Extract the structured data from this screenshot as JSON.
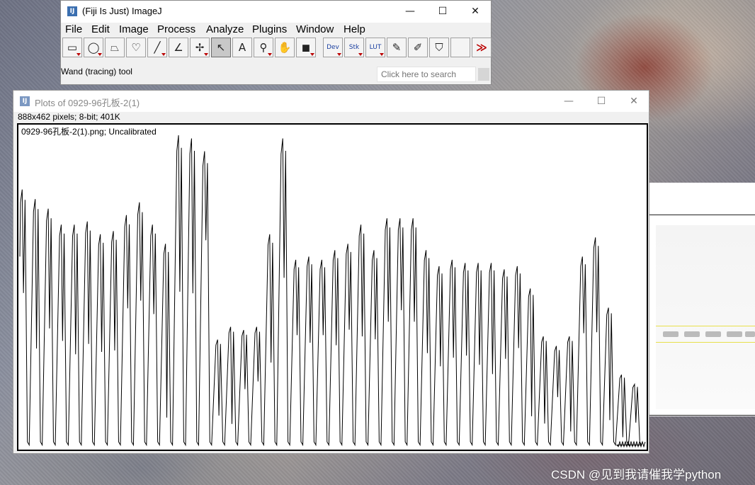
{
  "imagej": {
    "title": "(Fiji Is Just) ImageJ",
    "icon": "imagej-logo-icon",
    "window_controls": {
      "minimize": "—",
      "maximize": "☐",
      "close": "✕"
    },
    "menu": [
      "File",
      "Edit",
      "Image",
      "Process",
      "Analyze",
      "Plugins",
      "Window",
      "Help"
    ],
    "tools": [
      {
        "name": "rectangle-tool",
        "glyph": "▭",
        "dropdown": true
      },
      {
        "name": "oval-tool",
        "glyph": "◯",
        "dropdown": true
      },
      {
        "name": "polygon-tool",
        "glyph": "⏢",
        "dropdown": false
      },
      {
        "name": "freehand-tool",
        "glyph": "♡",
        "dropdown": false
      },
      {
        "name": "line-tool",
        "glyph": "╱",
        "dropdown": true
      },
      {
        "name": "angle-tool",
        "glyph": "∠",
        "dropdown": false
      },
      {
        "name": "multipoint-tool",
        "glyph": "✢",
        "dropdown": true
      },
      {
        "name": "wand-tool",
        "glyph": "↖",
        "dropdown": false,
        "active": true
      },
      {
        "name": "text-tool",
        "glyph": "A",
        "dropdown": false
      },
      {
        "name": "zoom-tool",
        "glyph": "⚲",
        "dropdown": true
      },
      {
        "name": "hand-tool",
        "glyph": "✋",
        "dropdown": false
      },
      {
        "name": "color-picker-tool",
        "glyph": "◼",
        "dropdown": true
      },
      {
        "name": "dev-menu",
        "glyph": "Dev",
        "dropdown": true,
        "text": true
      },
      {
        "name": "stk-menu",
        "glyph": "Stk",
        "dropdown": true,
        "text": true
      },
      {
        "name": "lut-menu",
        "glyph": "LUT",
        "dropdown": true,
        "text": true
      },
      {
        "name": "pencil-tool",
        "glyph": "✎",
        "dropdown": false
      },
      {
        "name": "brush-tool",
        "glyph": "✐",
        "dropdown": false
      },
      {
        "name": "flood-fill-tool",
        "glyph": "⛉",
        "dropdown": false
      },
      {
        "name": "empty-tool-slot",
        "glyph": "",
        "dropdown": false
      },
      {
        "name": "more-tools-arrow",
        "glyph": "≫",
        "dropdown": false
      }
    ],
    "status": "Wand (tracing) tool",
    "search_placeholder": "Click here to search"
  },
  "plot_window": {
    "title": "Plots of 0929-96孔板-2(1)",
    "info": "888x462 pixels; 8-bit; 401K",
    "canvas_label": "0929-96孔板-2(1).png; Uncalibrated"
  },
  "chart_data": {
    "type": "line",
    "title": "",
    "xlabel": "",
    "ylabel": "",
    "grid": false,
    "ylim": [
      0,
      1
    ],
    "series": [
      {
        "peaks": [
          0.81,
          0.78,
          0.75,
          0.7,
          0.7,
          0.71,
          0.67,
          0.68,
          0.73,
          0.77,
          0.7,
          0.64,
          0.98,
          0.97,
          0.93,
          0.34,
          0.38,
          0.37,
          0.38,
          0.67,
          0.97,
          0.59,
          0.6,
          0.59,
          0.62,
          0.64,
          0.7,
          0.62,
          0.72,
          0.72,
          0.72,
          0.62,
          0.57,
          0.59,
          0.58,
          0.58,
          0.58,
          0.56,
          0.57,
          0.5,
          0.35,
          0.32,
          0.35,
          0.6,
          0.66,
          0.44,
          0.23,
          0.2
        ],
        "valleys": [
          0.6,
          0.4,
          0.5,
          0.48,
          0.42,
          0.46,
          0.45,
          0.45,
          0.6,
          0.6,
          0.6,
          0.15,
          0.5,
          0.5,
          0.7,
          0.3,
          0.2,
          0.5,
          0.55,
          0.4,
          0.55,
          0.6,
          0.55,
          0.6,
          0.52,
          0.58,
          0.5,
          0.55,
          0.55,
          0.6,
          0.55,
          0.48,
          0.45,
          0.48,
          0.5,
          0.45,
          0.4,
          0.5,
          0.55,
          0.2,
          0.22,
          0.5,
          0.15,
          0.6,
          0.55,
          0.2,
          0.15
        ]
      }
    ]
  },
  "desktop": {
    "watermark": "CSDN @见到我请催我学python"
  }
}
